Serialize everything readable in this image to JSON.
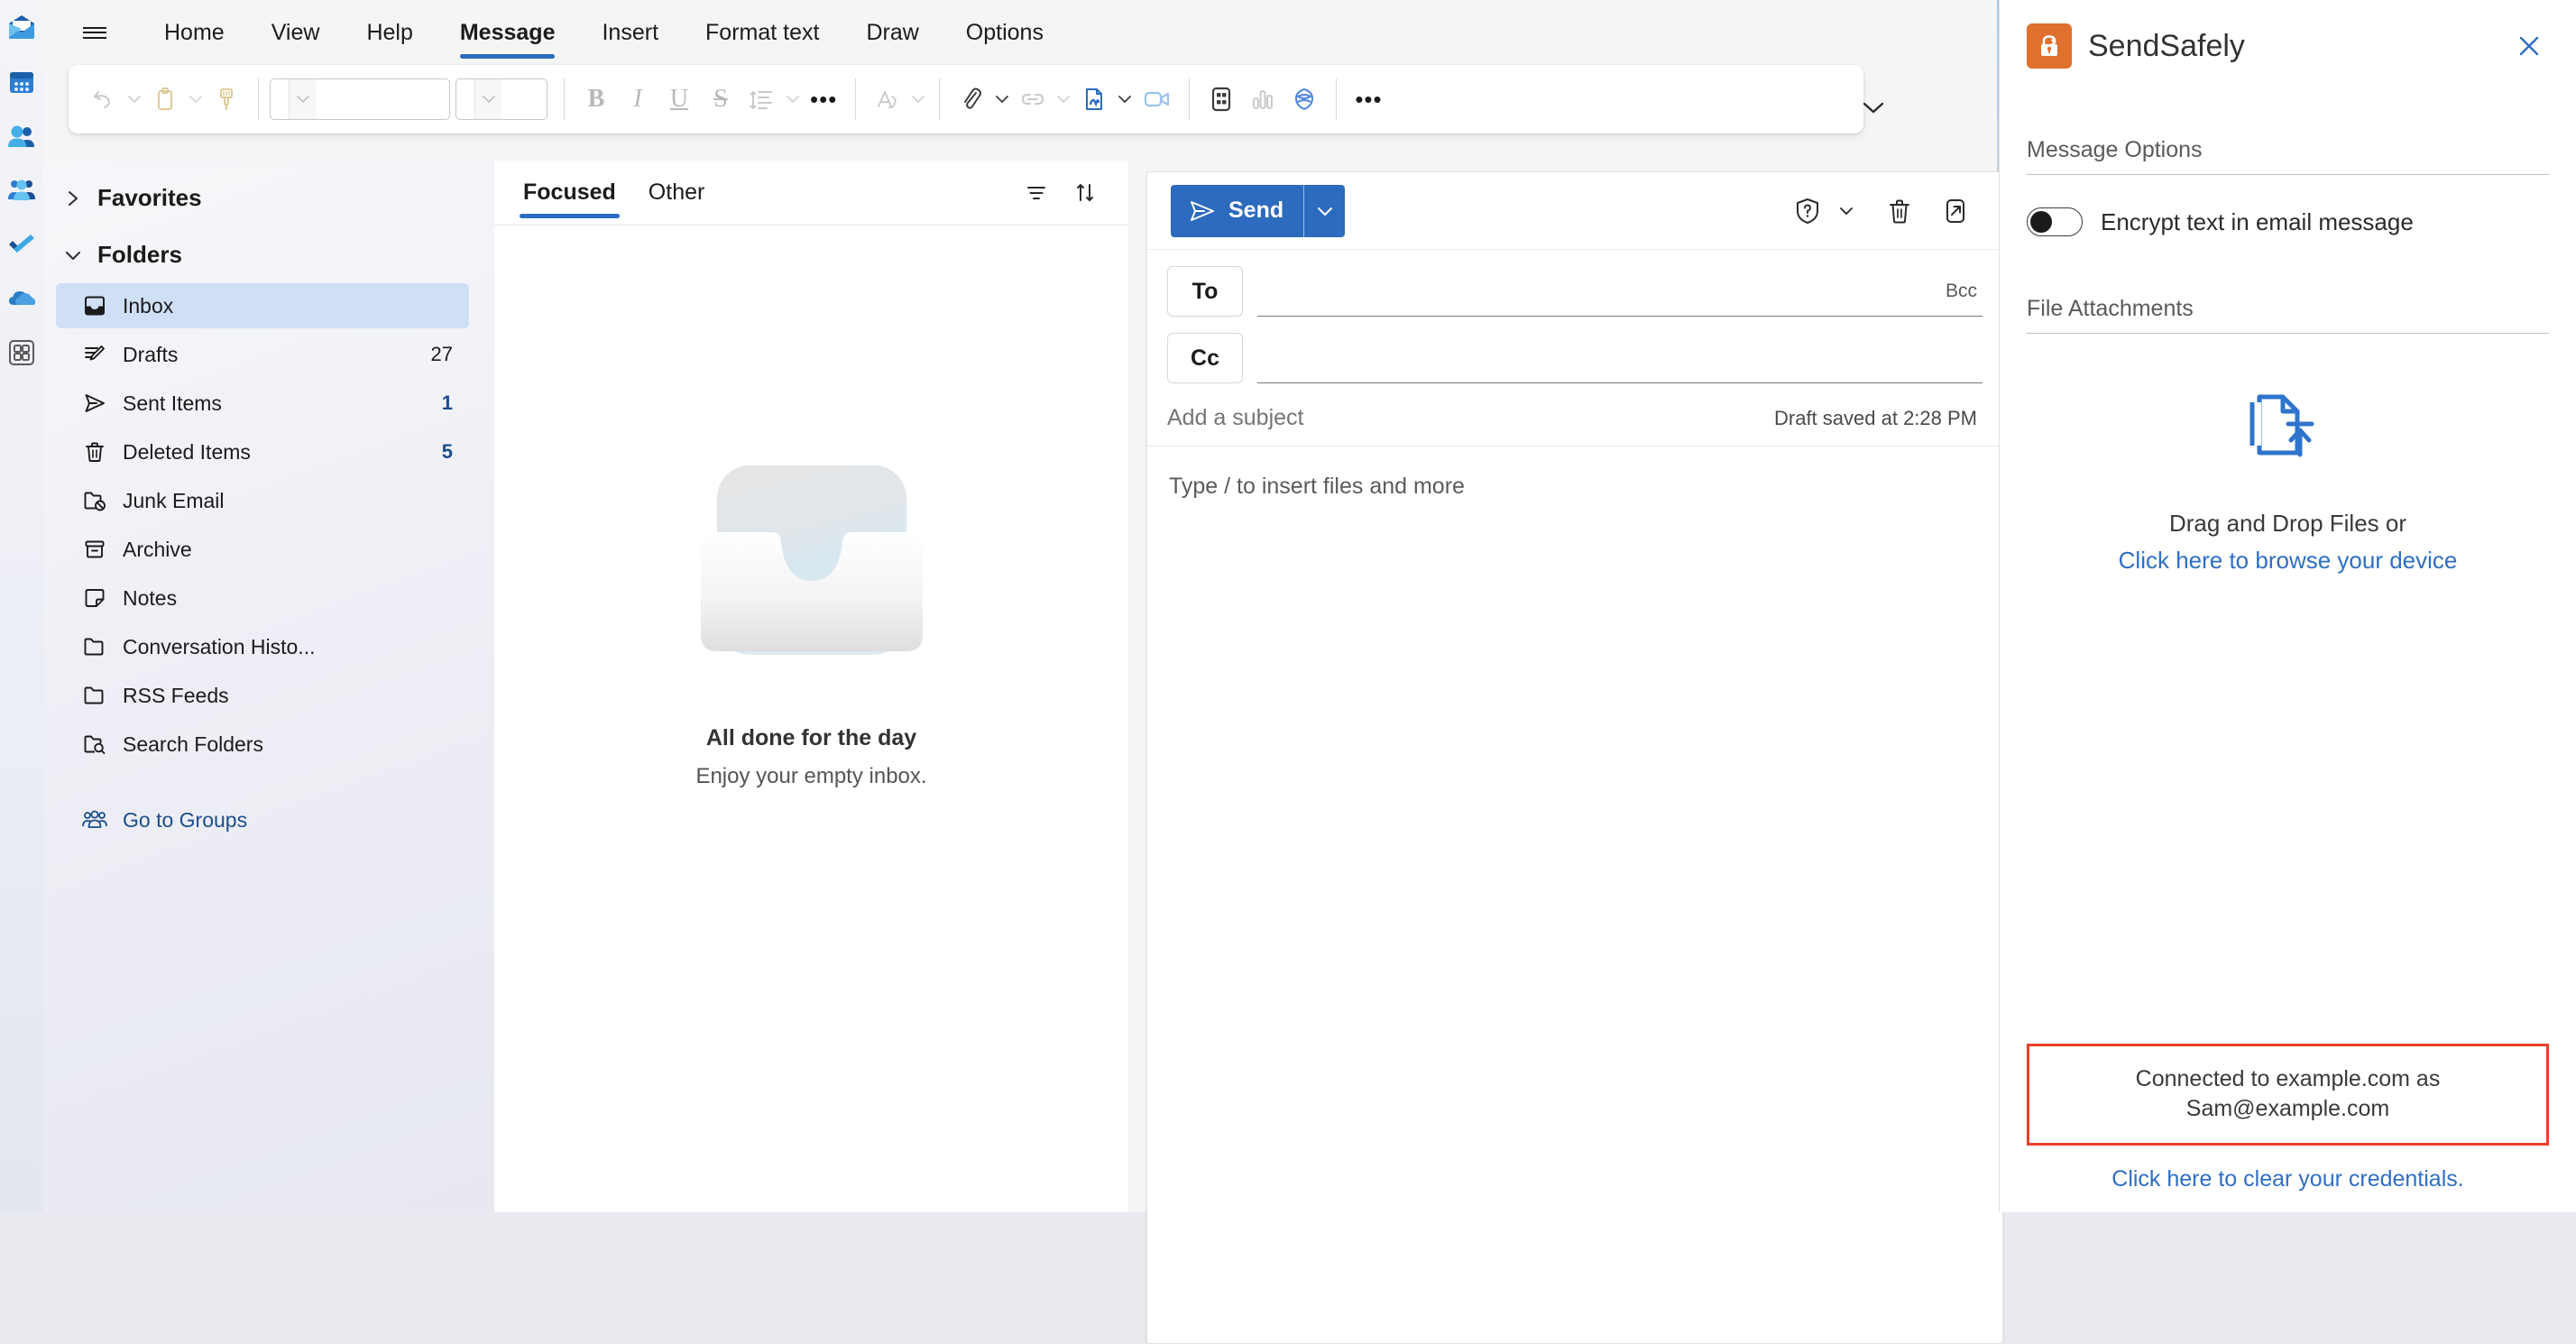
{
  "app_rail": {
    "items": [
      {
        "name": "mail",
        "label": "Mail"
      },
      {
        "name": "calendar",
        "label": "Calendar"
      },
      {
        "name": "people",
        "label": "People"
      },
      {
        "name": "teams",
        "label": "Teams"
      },
      {
        "name": "todo",
        "label": "To Do"
      },
      {
        "name": "onedrive",
        "label": "OneDrive"
      },
      {
        "name": "apps",
        "label": "More apps"
      }
    ]
  },
  "ribbon": {
    "menu_icon": "hamburger-icon",
    "tabs": [
      {
        "label": "Home",
        "active": false
      },
      {
        "label": "View",
        "active": false
      },
      {
        "label": "Help",
        "active": false
      },
      {
        "label": "Message",
        "active": true
      },
      {
        "label": "Insert",
        "active": false
      },
      {
        "label": "Format text",
        "active": false
      },
      {
        "label": "Draw",
        "active": false
      },
      {
        "label": "Options",
        "active": false
      }
    ],
    "commands": [
      {
        "name": "undo",
        "icon": "undo-icon"
      },
      {
        "name": "paste",
        "icon": "paste-icon"
      },
      {
        "name": "format-painter",
        "icon": "format-painter-icon"
      },
      {
        "name": "bold",
        "icon": "bold-icon",
        "glyph": "B"
      },
      {
        "name": "italic",
        "icon": "italic-icon",
        "glyph": "I"
      },
      {
        "name": "underline",
        "icon": "underline-icon",
        "glyph": "U"
      },
      {
        "name": "strikethrough",
        "icon": "strikethrough-icon",
        "glyph": "S"
      },
      {
        "name": "line-spacing",
        "icon": "line-spacing-icon"
      },
      {
        "name": "more-format",
        "icon": "ellipsis-icon"
      },
      {
        "name": "text-styles",
        "icon": "text-styles-icon"
      },
      {
        "name": "attach-file",
        "icon": "paperclip-icon"
      },
      {
        "name": "link",
        "icon": "link-icon"
      },
      {
        "name": "signature",
        "icon": "signature-icon"
      },
      {
        "name": "video-meeting",
        "icon": "video-camera-icon"
      },
      {
        "name": "apps",
        "icon": "apps-grid-icon"
      },
      {
        "name": "poll",
        "icon": "poll-chart-icon"
      },
      {
        "name": "sendsafely",
        "icon": "sendsafely-icon"
      },
      {
        "name": "more-commands",
        "icon": "ellipsis-icon"
      }
    ],
    "font_name": "",
    "font_size": "",
    "font_name_placeholder": "",
    "font_size_placeholder": "",
    "collapse_icon": "chevron-down-icon"
  },
  "folder_pane": {
    "favorites": {
      "label": "Favorites",
      "expanded": false,
      "chevron": "chevron-right-icon"
    },
    "folders_group": {
      "label": "Folders",
      "expanded": true,
      "chevron": "chevron-down-icon"
    },
    "items": [
      {
        "label": "Inbox",
        "count": "",
        "icon": "inbox-icon",
        "selected": true
      },
      {
        "label": "Drafts",
        "count": "27",
        "icon": "drafts-pencil-icon",
        "selected": false
      },
      {
        "label": "Sent Items",
        "count": "1",
        "icon": "send-arrow-icon",
        "selected": false,
        "count_accent": true
      },
      {
        "label": "Deleted Items",
        "count": "5",
        "icon": "trash-icon",
        "selected": false,
        "count_accent": true
      },
      {
        "label": "Junk Email",
        "count": "",
        "icon": "junk-folder-icon",
        "selected": false
      },
      {
        "label": "Archive",
        "count": "",
        "icon": "archive-box-icon",
        "selected": false
      },
      {
        "label": "Notes",
        "count": "",
        "icon": "note-icon",
        "selected": false
      },
      {
        "label": "Conversation Histo...",
        "count": "",
        "icon": "folder-icon",
        "selected": false
      },
      {
        "label": "RSS Feeds",
        "count": "",
        "icon": "folder-icon",
        "selected": false
      },
      {
        "label": "Search Folders",
        "count": "",
        "icon": "folder-search-icon",
        "selected": false
      }
    ],
    "go_to_groups": {
      "label": "Go to Groups",
      "icon": "people-group-icon"
    }
  },
  "message_list": {
    "pivots": [
      {
        "label": "Focused",
        "active": true
      },
      {
        "label": "Other",
        "active": false
      }
    ],
    "filter_icon": "filter-icon",
    "sort_icon": "sort-arrows-icon",
    "empty_state": {
      "illustration": "empty-inbox-tray-illustration",
      "title": "All done for the day",
      "subtitle": "Enjoy your empty inbox."
    }
  },
  "compose": {
    "send_label": "Send",
    "send_icon": "send-arrow-icon",
    "send_caret_icon": "chevron-down-icon",
    "toolbar_buttons": [
      {
        "name": "sensitivity",
        "icon": "shield-question-icon"
      },
      {
        "name": "sensitivity-caret",
        "icon": "chevron-down-icon"
      },
      {
        "name": "discard",
        "icon": "trash-icon"
      },
      {
        "name": "pop-out",
        "icon": "popout-arrow-icon"
      }
    ],
    "to_label": "To",
    "to_value": "",
    "to_placeholder": "",
    "bcc_label": "Bcc",
    "cc_label": "Cc",
    "cc_value": "",
    "cc_placeholder": "",
    "subject_value": "",
    "subject_placeholder": "Add a subject",
    "draft_status": "Draft saved at 2:28 PM",
    "body_placeholder": "Type / to insert files and more"
  },
  "sendsafely": {
    "title": "SendSafely",
    "logo_icon": "sendsafely-padlock-icon",
    "close_icon": "close-icon",
    "message_options_title": "Message Options",
    "encrypt_toggle": {
      "label": "Encrypt text in email message",
      "state": "off"
    },
    "file_attachments_title": "File Attachments",
    "upload_icon": "file-upload-icon",
    "dropzone_text": "Drag and Drop Files or",
    "dropzone_link": "Click here to browse your device",
    "status_text": "Connected to example.com as Sam@example.com",
    "clear_credentials_link": "Click here to clear your credentials.",
    "colors": {
      "brand_orange": "#e0702e",
      "accent_blue": "#2f6fc4",
      "status_border_red": "#e8412a"
    }
  },
  "colors": {
    "outlook_accent": "#2c6bbd",
    "selected_folder_bg": "#cfdff6",
    "link_blue": "#1c4d8f"
  }
}
